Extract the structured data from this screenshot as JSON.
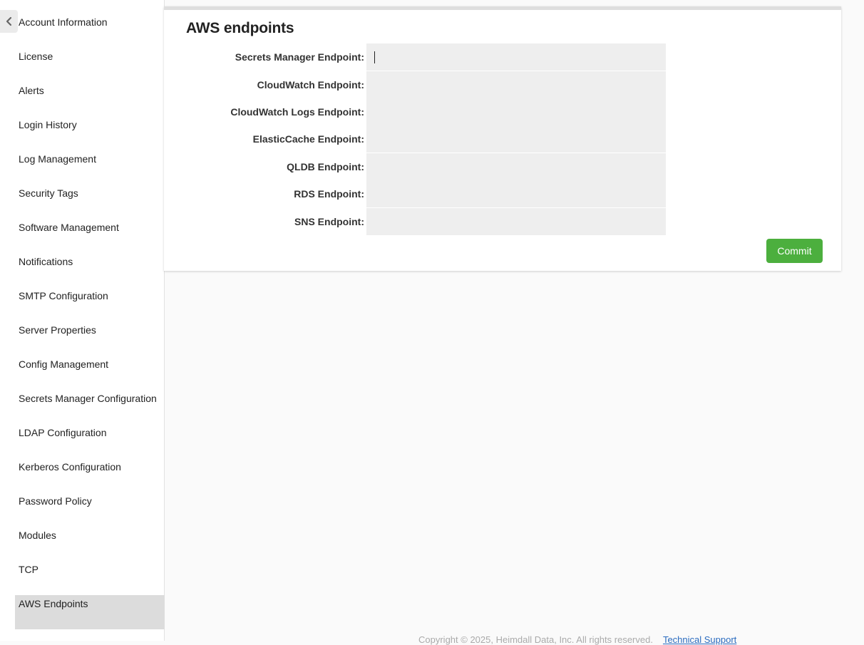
{
  "sidebar": {
    "items": [
      {
        "label": "Account Information"
      },
      {
        "label": "License"
      },
      {
        "label": "Alerts"
      },
      {
        "label": "Login History"
      },
      {
        "label": "Log Management"
      },
      {
        "label": "Security Tags"
      },
      {
        "label": "Software Management"
      },
      {
        "label": "Notifications"
      },
      {
        "label": "SMTP Configuration"
      },
      {
        "label": "Server Properties"
      },
      {
        "label": "Config Management"
      },
      {
        "label": "Secrets Manager Configuration"
      },
      {
        "label": "LDAP Configuration"
      },
      {
        "label": "Kerberos Configuration"
      },
      {
        "label": "Password Policy"
      },
      {
        "label": "Modules"
      },
      {
        "label": "TCP"
      },
      {
        "label": "AWS Endpoints"
      }
    ],
    "active_item": "AWS Endpoints",
    "collapse_icon": "chevron-left-icon"
  },
  "panel": {
    "title": "AWS endpoints",
    "fields": [
      {
        "label": "Secrets Manager Endpoint:",
        "value": ""
      },
      {
        "label": "CloudWatch Endpoint:",
        "value": ""
      },
      {
        "label": "CloudWatch Logs Endpoint:",
        "value": ""
      },
      {
        "label": "ElasticCache Endpoint:",
        "value": ""
      },
      {
        "label": "QLDB Endpoint:",
        "value": ""
      },
      {
        "label": "RDS Endpoint:",
        "value": ""
      },
      {
        "label": "SNS Endpoint:",
        "value": ""
      }
    ],
    "commit_label": "Commit"
  },
  "footer": {
    "copyright": "Copyright © 2025, Heimdall Data, Inc. All rights reserved.",
    "support_link": "Technical Support"
  },
  "colors": {
    "accent": "#4caf3e",
    "active_nav": "#dcdcdc",
    "input_bg": "#eeeeee",
    "link": "#2a6bbf"
  }
}
